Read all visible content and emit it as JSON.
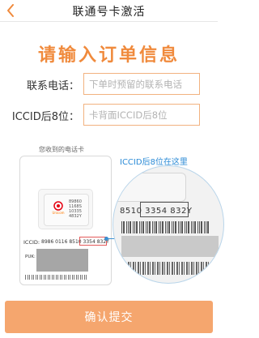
{
  "header": {
    "title": "联通号卡激活"
  },
  "main": {
    "title": "请输入订单信息"
  },
  "form": {
    "phone": {
      "label": "联系电话：",
      "placeholder": "下单时预留的联系电话"
    },
    "iccid": {
      "label": "ICCID后8位：",
      "placeholder": "卡背面ICCID后8位"
    }
  },
  "illustration": {
    "caption": "您收到的电话卡",
    "zoom_caption": "ICCID后8位在这里",
    "card": {
      "brand": "Unicom",
      "chip_code": [
        "89860",
        "1168S",
        "10335",
        "4832Y"
      ],
      "iccid_label": "ICCID:",
      "iccid_value": "8986 0116 8510 3354 832Y",
      "puk_label": "PUK:"
    },
    "zoom": {
      "number": "8510 3354 832Y"
    }
  },
  "actions": {
    "submit_label": "确认提交"
  },
  "colors": {
    "accent": "#f08a3c",
    "button": "#f5a66e",
    "info_blue": "#2a8ad6",
    "highlight_red": "#e35a5a"
  }
}
